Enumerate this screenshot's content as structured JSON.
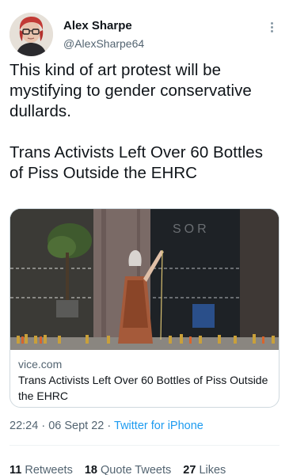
{
  "author": {
    "name": "Alex Sharpe",
    "handle": "@AlexSharpe64"
  },
  "tweet": {
    "line1": "This kind of art protest will be mystifying to gender conservative dullards.",
    "line2": "Trans Activists Left Over 60 Bottles of Piss Outside the EHRC"
  },
  "card": {
    "image_caption": "",
    "domain": "vice.com",
    "title": "Trans Activists Left Over 60 Bottles of Piss Outside the EHRC"
  },
  "meta": {
    "time": "22:24",
    "date": "06 Sept 22",
    "source": "Twitter for iPhone",
    "separator": "·"
  },
  "stats": {
    "retweets_count": "11",
    "retweets_label": "Retweets",
    "quotes_count": "18",
    "quotes_label": "Quote Tweets",
    "likes_count": "27",
    "likes_label": "Likes"
  },
  "colors": {
    "accent": "#1d9bf0",
    "secondary_text": "#536471",
    "primary_text": "#0f1419"
  }
}
